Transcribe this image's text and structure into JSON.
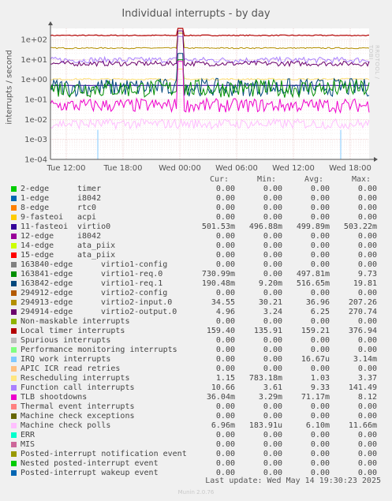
{
  "title": "Individual interrupts - by day",
  "side_label": "RRDTOOL / TOBI OETIKER",
  "last_update": "Last update: Wed May 14 19:30:23 2025",
  "footer": "Munin 2.0.76",
  "columns": {
    "cur": "Cur:",
    "min": "Min:",
    "avg": "Avg:",
    "max": "Max:"
  },
  "chart_data": {
    "type": "line",
    "title": "Individual interrupts - by day",
    "ylabel": "interrupts / second",
    "yscale": "log",
    "ylim": [
      0.0001,
      300
    ],
    "yticks": [
      "1e+02",
      "1e+01",
      "1e+00",
      "1e-01",
      "1e-02",
      "1e-03",
      "1e-04"
    ],
    "xticks": [
      "Tue 12:00",
      "Tue 18:00",
      "Wed 00:00",
      "Wed 06:00",
      "Wed 12:00",
      "Wed 18:00"
    ],
    "grid": true,
    "series": [
      {
        "name": "2-edge",
        "desc": "timer",
        "color": "#00cc00",
        "cur": "0.00",
        "min": "0.00",
        "avg": "0.00",
        "max": "0.00"
      },
      {
        "name": "1-edge",
        "desc": "i8042",
        "color": "#0066b3",
        "cur": "0.00",
        "min": "0.00",
        "avg": "0.00",
        "max": "0.00"
      },
      {
        "name": "8-edge",
        "desc": "rtc0",
        "color": "#ff8000",
        "cur": "0.00",
        "min": "0.00",
        "avg": "0.00",
        "max": "0.00"
      },
      {
        "name": "9-fasteoi",
        "desc": "acpi",
        "color": "#ffcc00",
        "cur": "0.00",
        "min": "0.00",
        "avg": "0.00",
        "max": "0.00"
      },
      {
        "name": "11-fasteoi",
        "desc": "virtio0",
        "color": "#330099",
        "cur": "501.53m",
        "min": "496.88m",
        "avg": "499.89m",
        "max": "503.22m"
      },
      {
        "name": "12-edge",
        "desc": "i8042",
        "color": "#990099",
        "cur": "0.00",
        "min": "0.00",
        "avg": "0.00",
        "max": "0.00"
      },
      {
        "name": "14-edge",
        "desc": "ata_piix",
        "color": "#ccff00",
        "cur": "0.00",
        "min": "0.00",
        "avg": "0.00",
        "max": "0.00"
      },
      {
        "name": "15-edge",
        "desc": "ata_piix",
        "color": "#ff0000",
        "cur": "0.00",
        "min": "0.00",
        "avg": "0.00",
        "max": "0.00"
      },
      {
        "name": "163840-edge",
        "desc": "virtio1-config",
        "color": "#808080",
        "cur": "0.00",
        "min": "0.00",
        "avg": "0.00",
        "max": "0.00"
      },
      {
        "name": "163841-edge",
        "desc": "virtio1-req.0",
        "color": "#008f00",
        "cur": "730.99m",
        "min": "0.00",
        "avg": "497.81m",
        "max": "9.73"
      },
      {
        "name": "163842-edge",
        "desc": "virtio1-req.1",
        "color": "#00487d",
        "cur": "190.48m",
        "min": "9.20m",
        "avg": "516.65m",
        "max": "19.81"
      },
      {
        "name": "294912-edge",
        "desc": "virtio2-config",
        "color": "#b35a00",
        "cur": "0.00",
        "min": "0.00",
        "avg": "0.00",
        "max": "0.00"
      },
      {
        "name": "294913-edge",
        "desc": "virtio2-input.0",
        "color": "#b38f00",
        "cur": "34.55",
        "min": "30.21",
        "avg": "36.96",
        "max": "207.26"
      },
      {
        "name": "294914-edge",
        "desc": "virtio2-output.0",
        "color": "#6b006b",
        "cur": "4.96",
        "min": "3.24",
        "avg": "6.25",
        "max": "270.74"
      },
      {
        "name": "Non-maskable interrupts",
        "desc": "",
        "color": "#8fb300",
        "cur": "0.00",
        "min": "0.00",
        "avg": "0.00",
        "max": "0.00"
      },
      {
        "name": "Local timer interrupts",
        "desc": "",
        "color": "#b30000",
        "cur": "159.40",
        "min": "135.91",
        "avg": "159.21",
        "max": "376.94"
      },
      {
        "name": "Spurious interrupts",
        "desc": "",
        "color": "#bebebe",
        "cur": "0.00",
        "min": "0.00",
        "avg": "0.00",
        "max": "0.00"
      },
      {
        "name": "Performance monitoring interrupts",
        "desc": "",
        "color": "#80ff80",
        "cur": "0.00",
        "min": "0.00",
        "avg": "0.00",
        "max": "0.00"
      },
      {
        "name": "IRQ work interrupts",
        "desc": "",
        "color": "#80c9ff",
        "cur": "0.00",
        "min": "0.00",
        "avg": "16.67u",
        "max": "3.14m"
      },
      {
        "name": "APIC ICR read retries",
        "desc": "",
        "color": "#ffc080",
        "cur": "0.00",
        "min": "0.00",
        "avg": "0.00",
        "max": "0.00"
      },
      {
        "name": "Rescheduling interrupts",
        "desc": "",
        "color": "#ffe680",
        "cur": "1.15",
        "min": "783.18m",
        "avg": "1.03",
        "max": "3.37"
      },
      {
        "name": "Function call interrupts",
        "desc": "",
        "color": "#aa80ff",
        "cur": "10.66",
        "min": "3.61",
        "avg": "9.33",
        "max": "141.49"
      },
      {
        "name": "TLB shootdowns",
        "desc": "",
        "color": "#ee00cc",
        "cur": "36.04m",
        "min": "3.29m",
        "avg": "71.17m",
        "max": "8.12"
      },
      {
        "name": "Thermal event interrupts",
        "desc": "",
        "color": "#ff8080",
        "cur": "0.00",
        "min": "0.00",
        "avg": "0.00",
        "max": "0.00"
      },
      {
        "name": "Machine check exceptions",
        "desc": "",
        "color": "#666600",
        "cur": "0.00",
        "min": "0.00",
        "avg": "0.00",
        "max": "0.00"
      },
      {
        "name": "Machine check polls",
        "desc": "",
        "color": "#ffbfff",
        "cur": "6.96m",
        "min": "183.91u",
        "avg": "6.10m",
        "max": "11.66m"
      },
      {
        "name": "ERR",
        "desc": "",
        "color": "#00ffcc",
        "cur": "0.00",
        "min": "0.00",
        "avg": "0.00",
        "max": "0.00"
      },
      {
        "name": "MIS",
        "desc": "",
        "color": "#cc6699",
        "cur": "0.00",
        "min": "0.00",
        "avg": "0.00",
        "max": "0.00"
      },
      {
        "name": "Posted-interrupt notification event",
        "desc": "",
        "color": "#999900",
        "cur": "0.00",
        "min": "0.00",
        "avg": "0.00",
        "max": "0.00"
      },
      {
        "name": "Nested posted-interrupt event",
        "desc": "",
        "color": "#00cc00",
        "cur": "0.00",
        "min": "0.00",
        "avg": "0.00",
        "max": "0.00"
      },
      {
        "name": "Posted-interrupt wakeup event",
        "desc": "",
        "color": "#0066b3",
        "cur": "0.00",
        "min": "0.00",
        "avg": "0.00",
        "max": "0.00"
      }
    ]
  }
}
